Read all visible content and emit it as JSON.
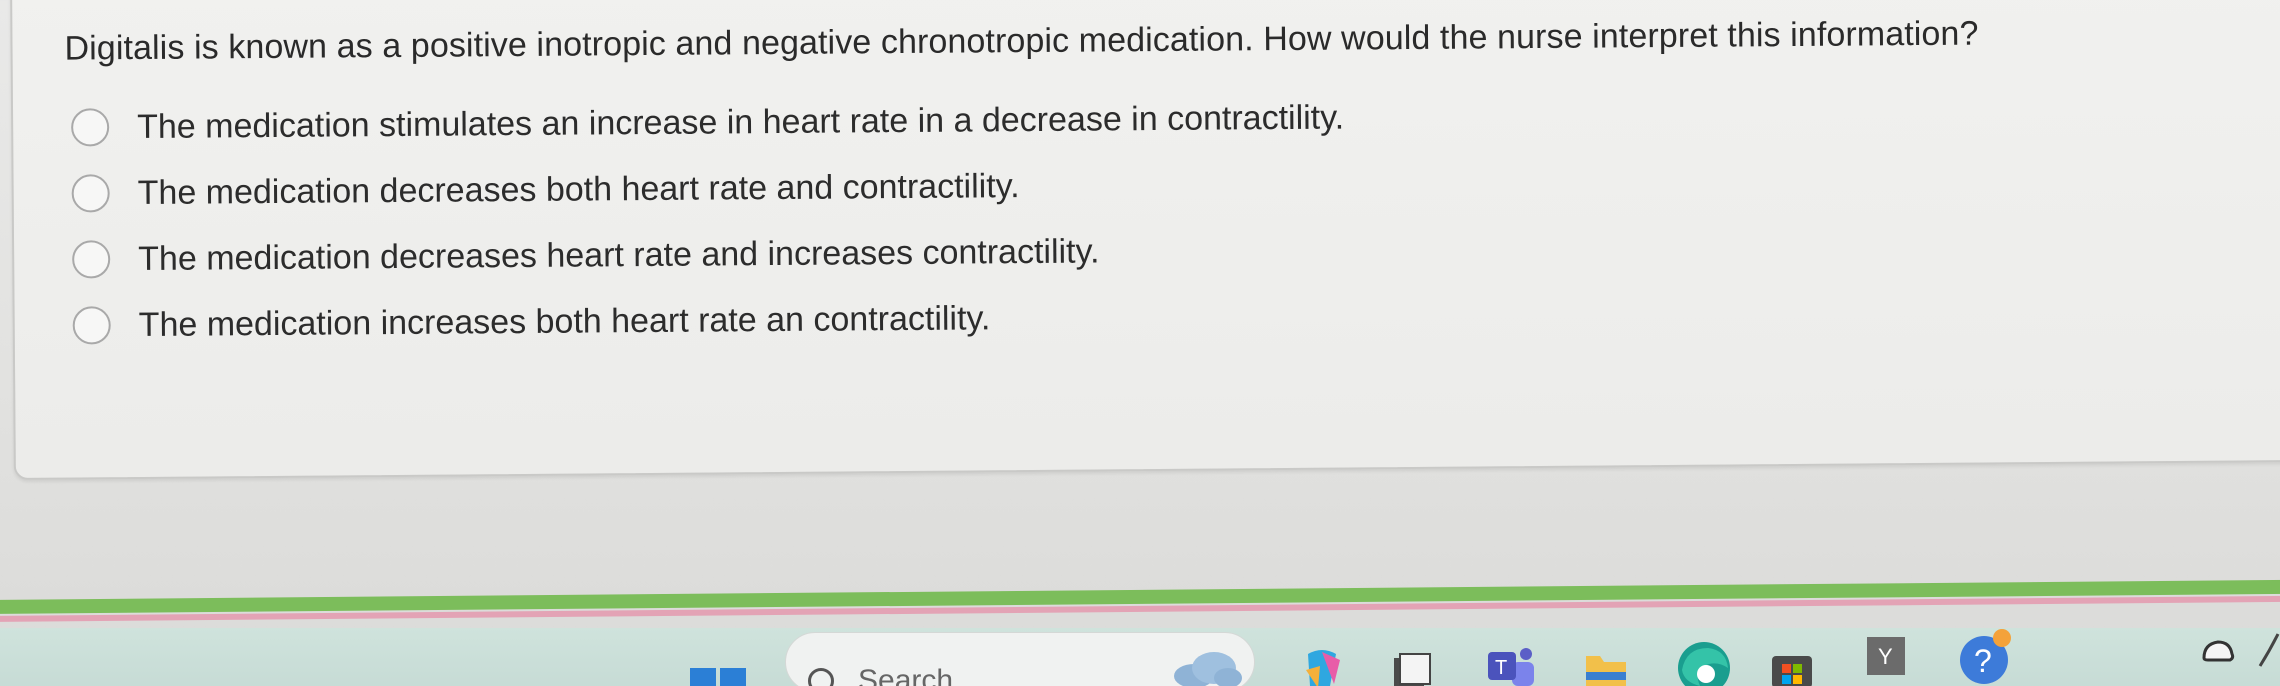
{
  "question": {
    "text": "Digitalis is known as a positive inotropic and negative chronotropic medication. How would the nurse interpret this information?"
  },
  "options": [
    {
      "label": "The medication stimulates an increase in heart rate in a decrease in contractility.",
      "selected": false
    },
    {
      "label": "The medication decreases both heart rate and contractility.",
      "selected": false
    },
    {
      "label": "The medication decreases heart rate and increases contractility.",
      "selected": false
    },
    {
      "label": "The medication increases both heart rate an contractility.",
      "selected": false
    }
  ],
  "taskbar": {
    "search_label": "Search",
    "icons": [
      "windows-start-icon",
      "search-icon",
      "weather-icon",
      "copilot-icon",
      "file-explorer-icon",
      "teams-icon",
      "folder-icon",
      "edge-icon",
      "microsoft-store-icon",
      "yahoo-icon",
      "help-icon",
      "onedrive-icon",
      "pen-icon"
    ]
  },
  "colors": {
    "accent_green": "#7cbd5b",
    "accent_pink": "#e3a3b5",
    "edge_teal": "#1a9e8f",
    "help_blue": "#3d7bd9"
  }
}
